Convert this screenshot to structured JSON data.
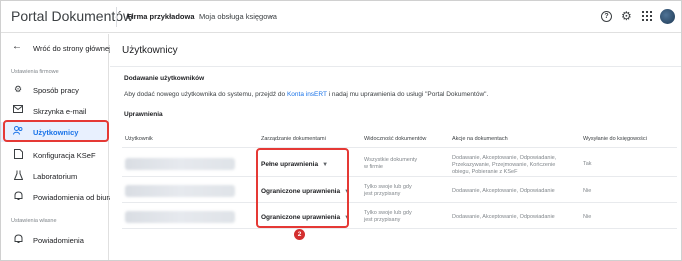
{
  "topbar": {
    "app_title": "Portal Dokumentów",
    "company": "Firma przykładowa",
    "office": "Moja obsługa księgowa",
    "icons": [
      "help-icon",
      "gear-icon",
      "apps-icon",
      "avatar"
    ]
  },
  "sidebar": {
    "back_label": "Wróć do strony głównej",
    "section_company": "Ustawienia firmowe",
    "section_own": "Ustawienia własne",
    "items": [
      {
        "label": "Sposób pracy",
        "icon": "gear-icon"
      },
      {
        "label": "Skrzynka e-mail",
        "icon": "mail-icon"
      },
      {
        "label": "Użytkownicy",
        "icon": "users-icon",
        "active": true
      },
      {
        "label": "Konfiguracja KSeF",
        "icon": "ksef-icon"
      },
      {
        "label": "Laboratorium",
        "icon": "flask-icon"
      },
      {
        "label": "Powiadomienia od biura",
        "icon": "bell-icon"
      }
    ],
    "own_items": [
      {
        "label": "Powiadomienia",
        "icon": "bell-icon"
      }
    ]
  },
  "callouts": {
    "one": "1",
    "two": "2"
  },
  "main": {
    "title": "Użytkownicy",
    "add_title": "Dodawanie użytkowników",
    "add_desc_before": "Aby dodać nowego użytkownika do systemu, przejdź do ",
    "add_desc_link": "Konta insERT",
    "add_desc_after": " i nadaj mu uprawnienia do usługi \"Portal Dokumentów\".",
    "perm_title": "Uprawnienia",
    "columns": [
      "Użytkownik",
      "Zarządzanie dokumentami",
      "Widoczność dokumentów",
      "Akcje na dokumentach",
      "Wysyłanie do księgowości"
    ],
    "rows": [
      {
        "permission": "Pełne uprawnienia",
        "visibility": [
          "Wszystkie dokumenty",
          "w firmie"
        ],
        "actions": [
          "Dodawanie, Akceptowanie, Odpowiadanie,",
          "Przekazywanie, Przejmowanie, Kończenie",
          "obiegu, Pobieranie z KSeF"
        ],
        "sending": "Tak"
      },
      {
        "permission": "Ograniczone uprawnienia",
        "visibility": [
          "Tylko swoje lub gdy",
          "jest przypisany"
        ],
        "actions": [
          "Dodawanie, Akceptowanie, Odpowiadanie"
        ],
        "sending": "Nie"
      },
      {
        "permission": "Ograniczone uprawnienia",
        "visibility": [
          "Tylko swoje lub gdy",
          "jest przypisany"
        ],
        "actions": [
          "Dodawanie, Akceptowanie, Odpowiadanie"
        ],
        "sending": "Nie"
      }
    ]
  }
}
